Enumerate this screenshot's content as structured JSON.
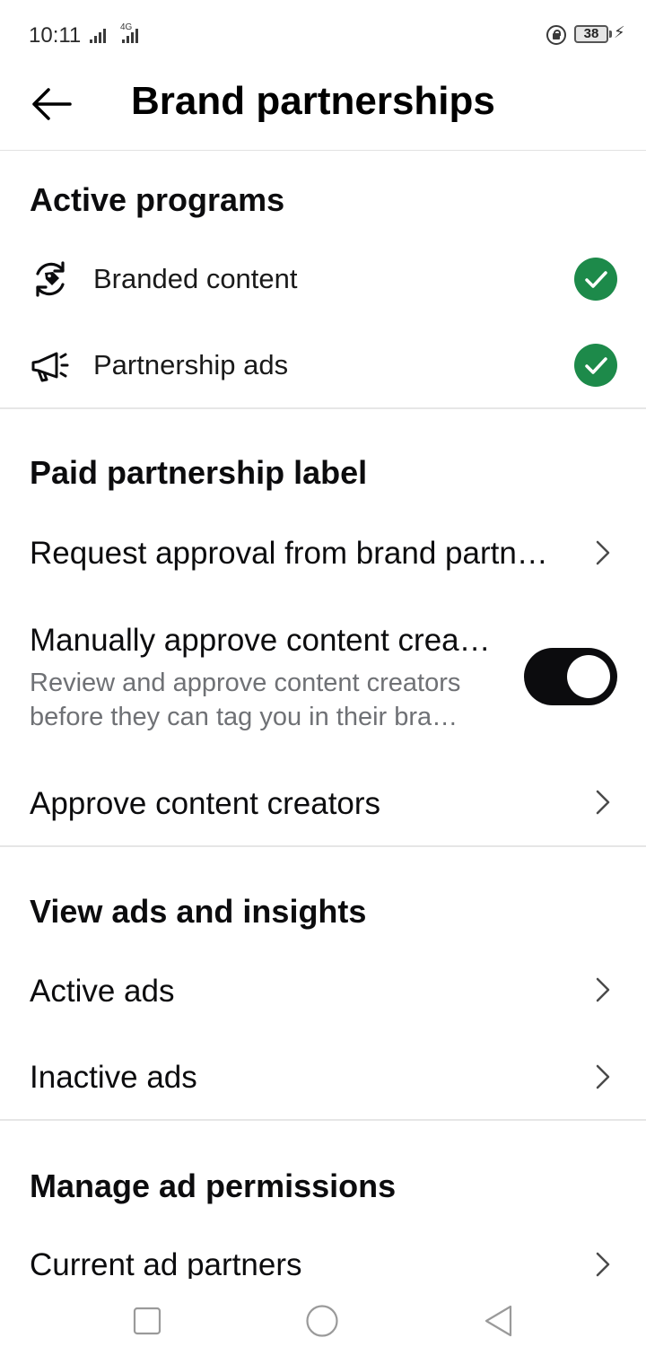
{
  "status_bar": {
    "time": "10:11",
    "network": "4G",
    "battery": "38"
  },
  "header": {
    "title": "Brand partnerships"
  },
  "active_programs": {
    "title": "Active programs",
    "items": [
      {
        "label": "Branded content",
        "icon": "branded-content-icon",
        "status": "active"
      },
      {
        "label": "Partnership ads",
        "icon": "megaphone-icon",
        "status": "active"
      }
    ]
  },
  "paid_partnership_label": {
    "title": "Paid partnership label",
    "request_approval": "Request approval from brand partn…",
    "manual_approve": {
      "title": "Manually approve content crea…",
      "description_line1": "Review and approve content creators",
      "description_line2": "before they can tag you in their bra…",
      "enabled": true
    },
    "approve_creators": "Approve content creators"
  },
  "view_ads": {
    "title": "View ads and insights",
    "active_ads": "Active ads",
    "inactive_ads": "Inactive ads"
  },
  "manage_permissions": {
    "title": "Manage ad permissions",
    "current_partners": "Current ad partners"
  },
  "colors": {
    "check_green": "#1d8a4a",
    "toggle_on": "#0c0c0e",
    "secondary_text": "#6f7175"
  }
}
